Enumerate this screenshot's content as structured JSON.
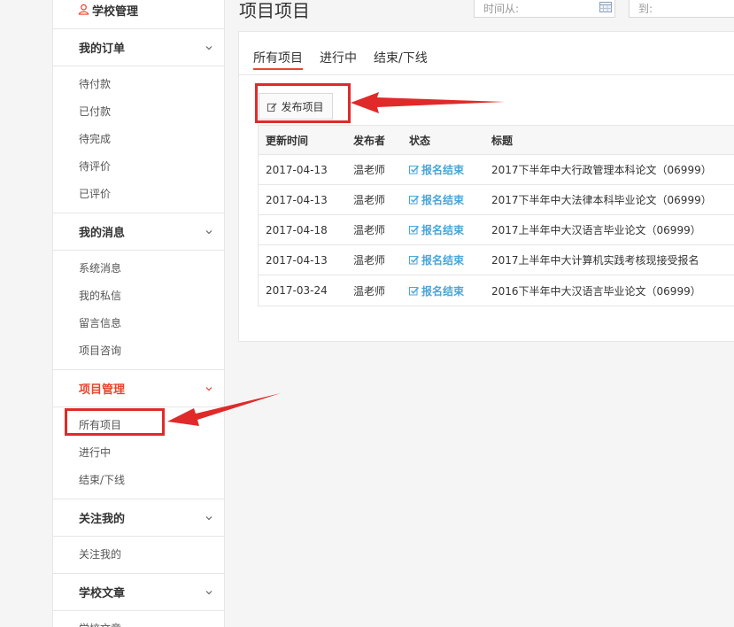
{
  "sidebar": {
    "top_label": "学校管理",
    "sections": [
      {
        "title": "我的订单",
        "items": [
          "待付款",
          "已付款",
          "待完成",
          "待评价",
          "已评价"
        ]
      },
      {
        "title": "我的消息",
        "items": [
          "系统消息",
          "我的私信",
          "留言信息",
          "项目咨询"
        ]
      },
      {
        "title": "项目管理",
        "items": [
          "所有项目",
          "进行中",
          "结束/下线"
        ]
      },
      {
        "title": "关注我的",
        "items": [
          "关注我的"
        ]
      },
      {
        "title": "学校文章",
        "items": [
          "学校文章"
        ]
      }
    ]
  },
  "header": {
    "title": "项目项目",
    "date_from_placeholder": "时间从:",
    "date_to_placeholder": "到:"
  },
  "tabs": [
    "所有项目",
    "进行中",
    "结束/下线"
  ],
  "publish_button": "发布项目",
  "table": {
    "columns": [
      "更新时间",
      "发布者",
      "状态",
      "标题"
    ],
    "rows": [
      {
        "date": "2017-04-13",
        "publisher": "温老师",
        "status": "报名结束",
        "title": "2017下半年中大行政管理本科论文（06999）"
      },
      {
        "date": "2017-04-13",
        "publisher": "温老师",
        "status": "报名结束",
        "title": "2017下半年中大法律本科毕业论文（06999）"
      },
      {
        "date": "2017-04-18",
        "publisher": "温老师",
        "status": "报名结束",
        "title": "2017上半年中大汉语言毕业论文（06999）"
      },
      {
        "date": "2017-04-13",
        "publisher": "温老师",
        "status": "报名结束",
        "title": "2017上半年中大计算机实践考核现接受报名"
      },
      {
        "date": "2017-03-24",
        "publisher": "温老师",
        "status": "报名结束",
        "title": "2016下半年中大汉语言毕业论文（06999）"
      }
    ]
  },
  "colors": {
    "accent": "#e8452e",
    "status": "#4aa6d8",
    "annotation": "#e02a2a"
  }
}
